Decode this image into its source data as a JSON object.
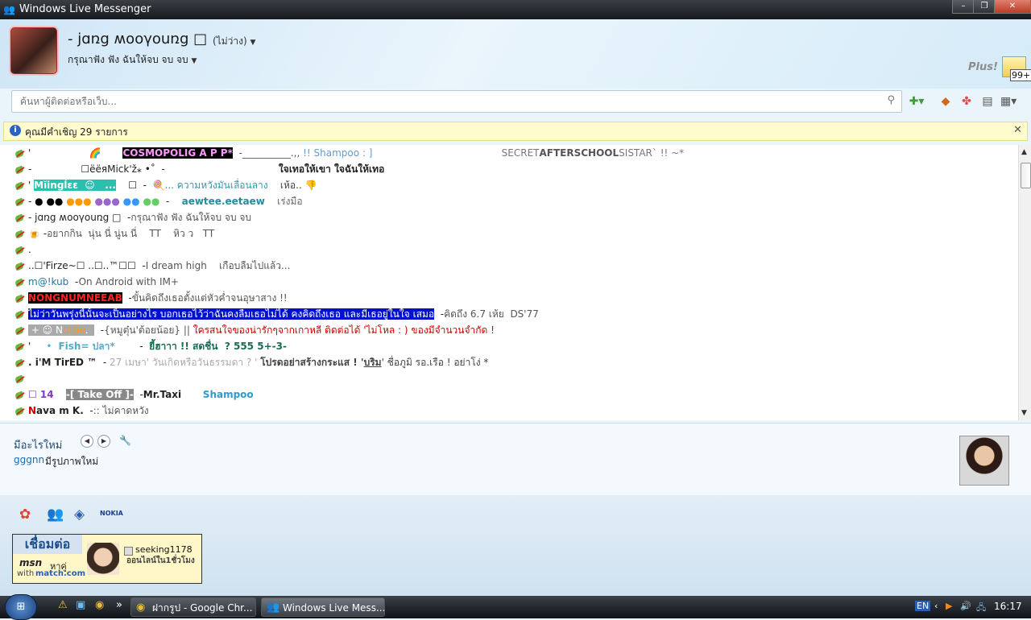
{
  "window": {
    "title": "Windows Live Messenger"
  },
  "profile": {
    "display_name": "- jɑռg ʍooγouռg □",
    "status": "(ไม่ว่าง)",
    "personal_message": "กรุณาฟัง ฟัง ฉันให้จบ จบ จบ"
  },
  "header": {
    "plus_label": "Plus!",
    "inbox_count": "99+"
  },
  "search": {
    "placeholder": "ค้นหาผู้ติดต่อหรือเว็บ..."
  },
  "invite": {
    "text": "คุณมีคำเชิญ 29 รายการ"
  },
  "contacts": [
    [
      {
        "t": "'                   "
      },
      {
        "t": "🌈",
        "c": "#e08a00"
      },
      {
        "t": "       "
      },
      {
        "t": "COSMOPOLIG A P P*",
        "c": "#ff99ff",
        "bg": "#000",
        "b": true
      },
      {
        "t": "  -__________.,, ",
        "c": "#555"
      },
      {
        "t": "!! Shampoo : ]",
        "c": "#6699cc"
      },
      {
        "t": "                                          SECRET",
        "c": "#777"
      },
      {
        "t": "AFTERSCHOOL",
        "c": "#555",
        "b": true
      },
      {
        "t": "SISTAR` !! ~*",
        "c": "#777"
      }
    ],
    [
      {
        "t": "-                ☐ëëяMick'ž⁎ •˚  -                                     "
      },
      {
        "t": "ใจเทอให้เขา ใจฉันให้เทอ",
        "b": true
      }
    ],
    [
      {
        "t": "' "
      },
      {
        "t": "Mĭingĺɛɛ  ☺   ...",
        "c": "#fff",
        "bg": "#2bbfb0",
        "b": true
      },
      {
        "t": "    ☐  -  "
      },
      {
        "t": "🍭",
        "c": "#d44"
      },
      {
        "t": "... ความหวังมันเลื่อนลาง",
        "c": "#3399aa"
      },
      {
        "t": "    เห้อ.. 👎",
        "c": "#444"
      }
    ],
    [
      {
        "t": "-"
      },
      {
        "t": " ● ●● ",
        "c": "#000"
      },
      {
        "t": "●●●",
        "c": "#ff9900"
      },
      {
        "t": " ●●●",
        "c": "#9966cc"
      },
      {
        "t": " ●● ",
        "c": "#3399ff"
      },
      {
        "t": "●● ",
        "c": "#66cc66"
      },
      {
        "t": " -    "
      },
      {
        "t": "aewtee.eetaew",
        "c": "#2a8a9a",
        "b": true
      },
      {
        "t": "    เร่งมือ",
        "c": "#666"
      }
    ],
    [
      {
        "t": "- jɑռg ʍooγouռg □  -"
      },
      {
        "t": "กรุณาฟัง ฟัง ฉันให้จบ จบ จบ",
        "c": "#555"
      }
    ],
    [
      {
        "t": "🍺 -"
      },
      {
        "t": "อยากกิน  นุ่น นี่ นู่น นี่    TT    หิว ว   TT",
        "c": "#555"
      }
    ],
    [
      {
        "t": "."
      }
    ],
    [
      {
        "t": "..☐'Firze~☐ ..☐..™☐☐  -"
      },
      {
        "t": "I dream high    เกือบลืมไปแล้ว...",
        "c": "#555"
      }
    ],
    [
      {
        "t": "m@!kub",
        "c": "#1a7a99"
      },
      {
        "t": "  -"
      },
      {
        "t": "On Android with IM+",
        "c": "#555"
      }
    ],
    [
      {
        "t": "NONGNUMNEEAB",
        "c": "#ff2222",
        "bg": "#000",
        "b": true
      },
      {
        "t": "  -"
      },
      {
        "t": "ขั้นคิดถึงเธอตั้งแต่หัวค่ำจนอุษาสาง !!",
        "c": "#555"
      }
    ],
    [
      {
        "t": "ไม่ว่าวันพรุ่งนี้นั้นจะเป็นอย่างไร บอกเธอไว้ว่าฉันคงลืมเธอไม่ได้ คงคิดถึงเธอ และมีเธอยู่ในใจ เสมอ",
        "c": "#fff",
        "bg": "#0011cc"
      },
      {
        "t": "  -"
      },
      {
        "t": "คิดถึง 6.7 เห้ย  DS'77",
        "c": "#555"
      }
    ],
    [
      {
        "t": " + ☺ N",
        "c": "#fff",
        "bg": "#aaa"
      },
      {
        "t": "uttie",
        "c": "#ff9900",
        "bg": "#aaa"
      },
      {
        "t": ".  ",
        "c": "#fff",
        "bg": "#aaa"
      },
      {
        "t": "  -"
      },
      {
        "t": "{หมูตุ๋น'ต้อยน้อย} || ",
        "c": "#555"
      },
      {
        "t": "ใครสนใจของน่ารักๆจากเกาหลี ติดต่อได้ 'ไม่โหล : ) ของมีจำนวนจำกัด !",
        "c": "#cc0000"
      }
    ],
    [
      {
        "t": "'     "
      },
      {
        "t": "• ",
        "c": "#66aacc"
      },
      {
        "t": " Fish= ปลา*",
        "c": "#55aacc",
        "b": true
      },
      {
        "t": "        -  "
      },
      {
        "t": "ยี้ฮาาา !! สดชื่น  ? 555 5+-3-",
        "c": "#1a6a55",
        "b": true
      }
    ],
    [
      {
        "t": ". i'M TirED ™",
        "b": true
      },
      {
        "t": "  - "
      },
      {
        "t": "27 เมษา' วันเกิดหรือวันธรรมดา ? ' ",
        "c": "#aaa"
      },
      {
        "t": "โปรดอย่าสร้างกระแส ! '",
        "c": "#444",
        "b": true
      },
      {
        "t": "บริม",
        "c": "#444",
        "b": true,
        "u": true
      },
      {
        "t": "' ชื่อภูมิ รอ.เรือ ! อย่าโง่ *",
        "c": "#444"
      }
    ],
    [
      {
        "t": ""
      }
    ],
    [
      {
        "t": "☐ 14",
        "c": "#8833cc",
        "b": true
      },
      {
        "t": "    "
      },
      {
        "t": "-[ Take Off ]-",
        "c": "#fff",
        "bg": "#888",
        "b": true
      },
      {
        "t": "  -"
      },
      {
        "t": "Mr.Taxi",
        "b": true
      },
      {
        "t": "       "
      },
      {
        "t": "Shampoo",
        "c": "#3399cc",
        "b": true
      }
    ],
    [
      {
        "t": "N",
        "c": "#cc0000",
        "b": true
      },
      {
        "t": "ava m K.",
        "b": true
      },
      {
        "t": "  -"
      },
      {
        "t": ":: ไม่คาดหวัง",
        "c": "#555"
      }
    ]
  ],
  "whats_new": {
    "title": "มีอะไรใหม่",
    "name": "gggnn",
    "description": "มีรูปภาพใหม่"
  },
  "footer": {
    "nokia_label": "NOKIA"
  },
  "ad": {
    "title": "เชื่อมต่อ",
    "msn": "msn",
    "find": "หาคู่",
    "with": "with",
    "match": "match.com",
    "username": "seeking1178",
    "online": "ออนไลน์ใน1ชั่วโมง"
  },
  "taskbar": {
    "chrome_task": "ฝากรูป - Google Chr...",
    "messenger_task": "Windows Live Mess...",
    "lang": "EN",
    "clock": "16:17"
  }
}
